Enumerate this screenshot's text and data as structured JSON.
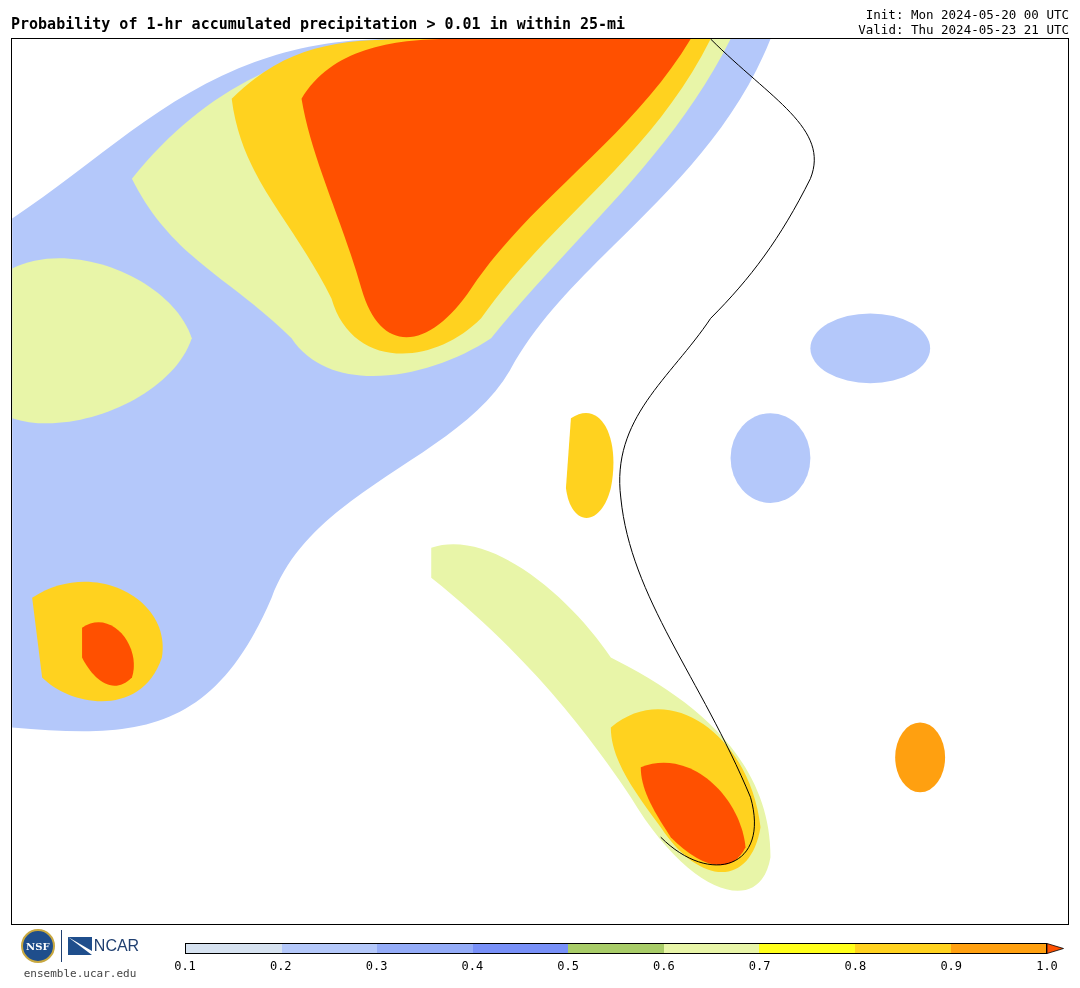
{
  "title": "Probability of 1-hr accumulated precipitation > 0.01 in within 25-mi",
  "init": "Init: Mon 2024-05-20 00 UTC",
  "valid": "Valid: Thu 2024-05-23 21 UTC",
  "logos": {
    "nsf": "NSF",
    "ncar": "NCAR",
    "site": "ensemble.ucar.edu"
  },
  "colorbar": {
    "bins": [
      {
        "color": "#d6e2f0"
      },
      {
        "color": "#b4c8fa"
      },
      {
        "color": "#94acf8"
      },
      {
        "color": "#7890f8"
      },
      {
        "color": "#a8cc68"
      },
      {
        "color": "#e8f5a8"
      },
      {
        "color": "#ffff1a"
      },
      {
        "color": "#ffd21f"
      },
      {
        "color": "#ffa010"
      }
    ],
    "extension": {
      "color": "#ff5000"
    },
    "ticks": [
      "0.1",
      "0.2",
      "0.3",
      "0.4",
      "0.5",
      "0.6",
      "0.7",
      "0.8",
      "0.9",
      "1.0"
    ]
  }
}
